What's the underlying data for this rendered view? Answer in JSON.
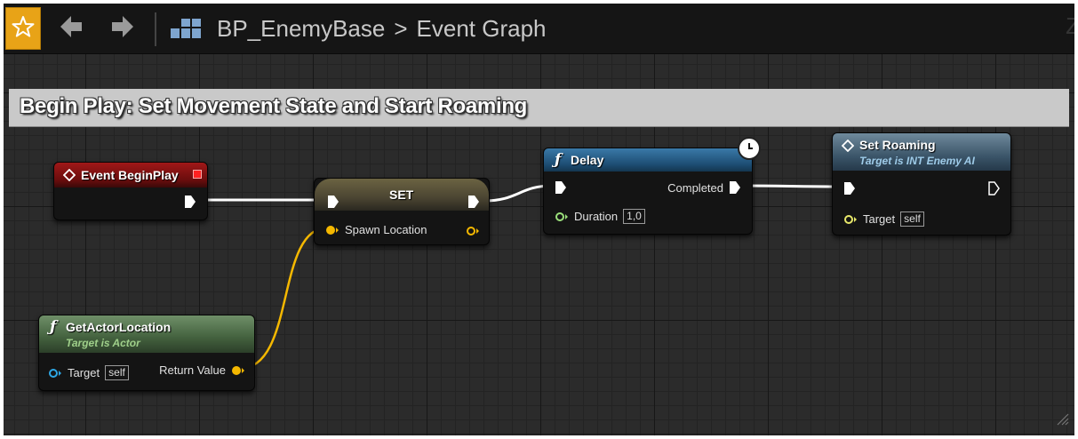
{
  "toolbar": {
    "favorite_icon": "star-icon",
    "back_icon": "back-arrow-icon",
    "forward_icon": "forward-arrow-icon",
    "blueprint_icon": "blueprint-class-icon",
    "breadcrumb": {
      "asset": "BP_EnemyBase",
      "separator": ">",
      "graph": "Event Graph"
    },
    "zoom_label": "Z"
  },
  "comment": {
    "title": "Begin Play: Set Movement State and Start Roaming"
  },
  "nodes": {
    "begin_play": {
      "title": "Event BeginPlay",
      "icon": "event-diamond-icon"
    },
    "set": {
      "title": "SET",
      "input_pin": "Spawn Location"
    },
    "delay": {
      "title": "Delay",
      "icon": "function-icon",
      "output_pin": "Completed",
      "param_label": "Duration",
      "param_value": "1,0"
    },
    "set_roaming": {
      "title": "Set Roaming",
      "subtitle": "Target is INT Enemy AI",
      "icon": "interface-message-icon",
      "param_label": "Target",
      "param_value": "self"
    },
    "get_actor_location": {
      "title": "GetActorLocation",
      "subtitle": "Target is Actor",
      "icon": "function-icon",
      "param_label": "Target",
      "param_value": "self",
      "output_pin": "Return Value"
    }
  },
  "colors": {
    "exec_wire": "#ffffff",
    "vector_wire": "#f5b800",
    "object_pin": "#2ea8e6",
    "float_pin": "#9be07b",
    "interface_pin": "#e8e86a",
    "favorite_bg": "#e8a317"
  }
}
